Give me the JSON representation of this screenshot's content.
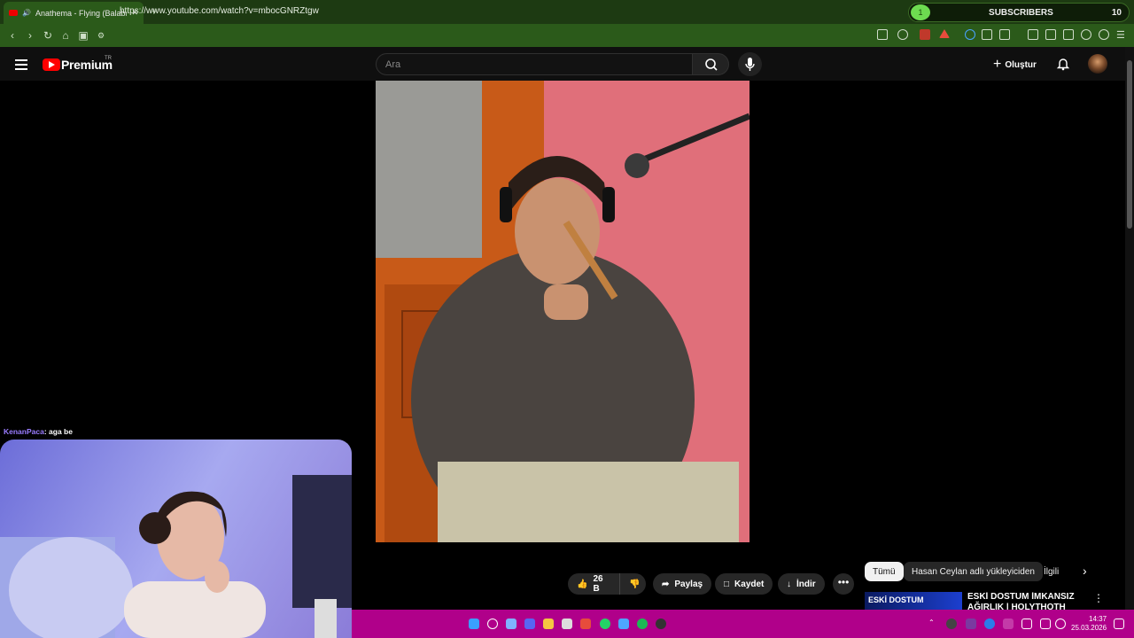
{
  "browser": {
    "tab_title": "Anathema - Flying (Balaban/I",
    "new_tab": "+",
    "close": "✕",
    "url": "https://www.youtube.com/watch?v=mbocGNRZtgw",
    "subscribers_widget": {
      "progress_digit": "1",
      "label": "SUBSCRIBERS",
      "count": "10"
    }
  },
  "youtube": {
    "brand": "Premium",
    "region": "TR",
    "search_placeholder": "Ara",
    "create_label": "Oluştur",
    "actions": {
      "like_count": "26 B",
      "share": "Paylaş",
      "save": "Kaydet",
      "download": "İndir",
      "more": "•••"
    },
    "chips": [
      "Tümü",
      "Hasan Ceylan adlı yükleyiciden",
      "İlgili"
    ],
    "recommendation": {
      "thumb_text": "ESKİ DOSTUM",
      "title": "ESKİ DOSTUM İMKANSIZ AĞIRLIK | HOLYTHOTH TET"
    }
  },
  "chat": {
    "user": "KenanPaca",
    "message": ": aga be"
  },
  "taskbar": {
    "time": "14:37",
    "date": "25.03.2026"
  },
  "colors": {
    "tab_strip": "#1d3a12",
    "address_bar": "#2b5a1a",
    "taskbar": "#b0008a",
    "yt_red": "#ff0000"
  }
}
